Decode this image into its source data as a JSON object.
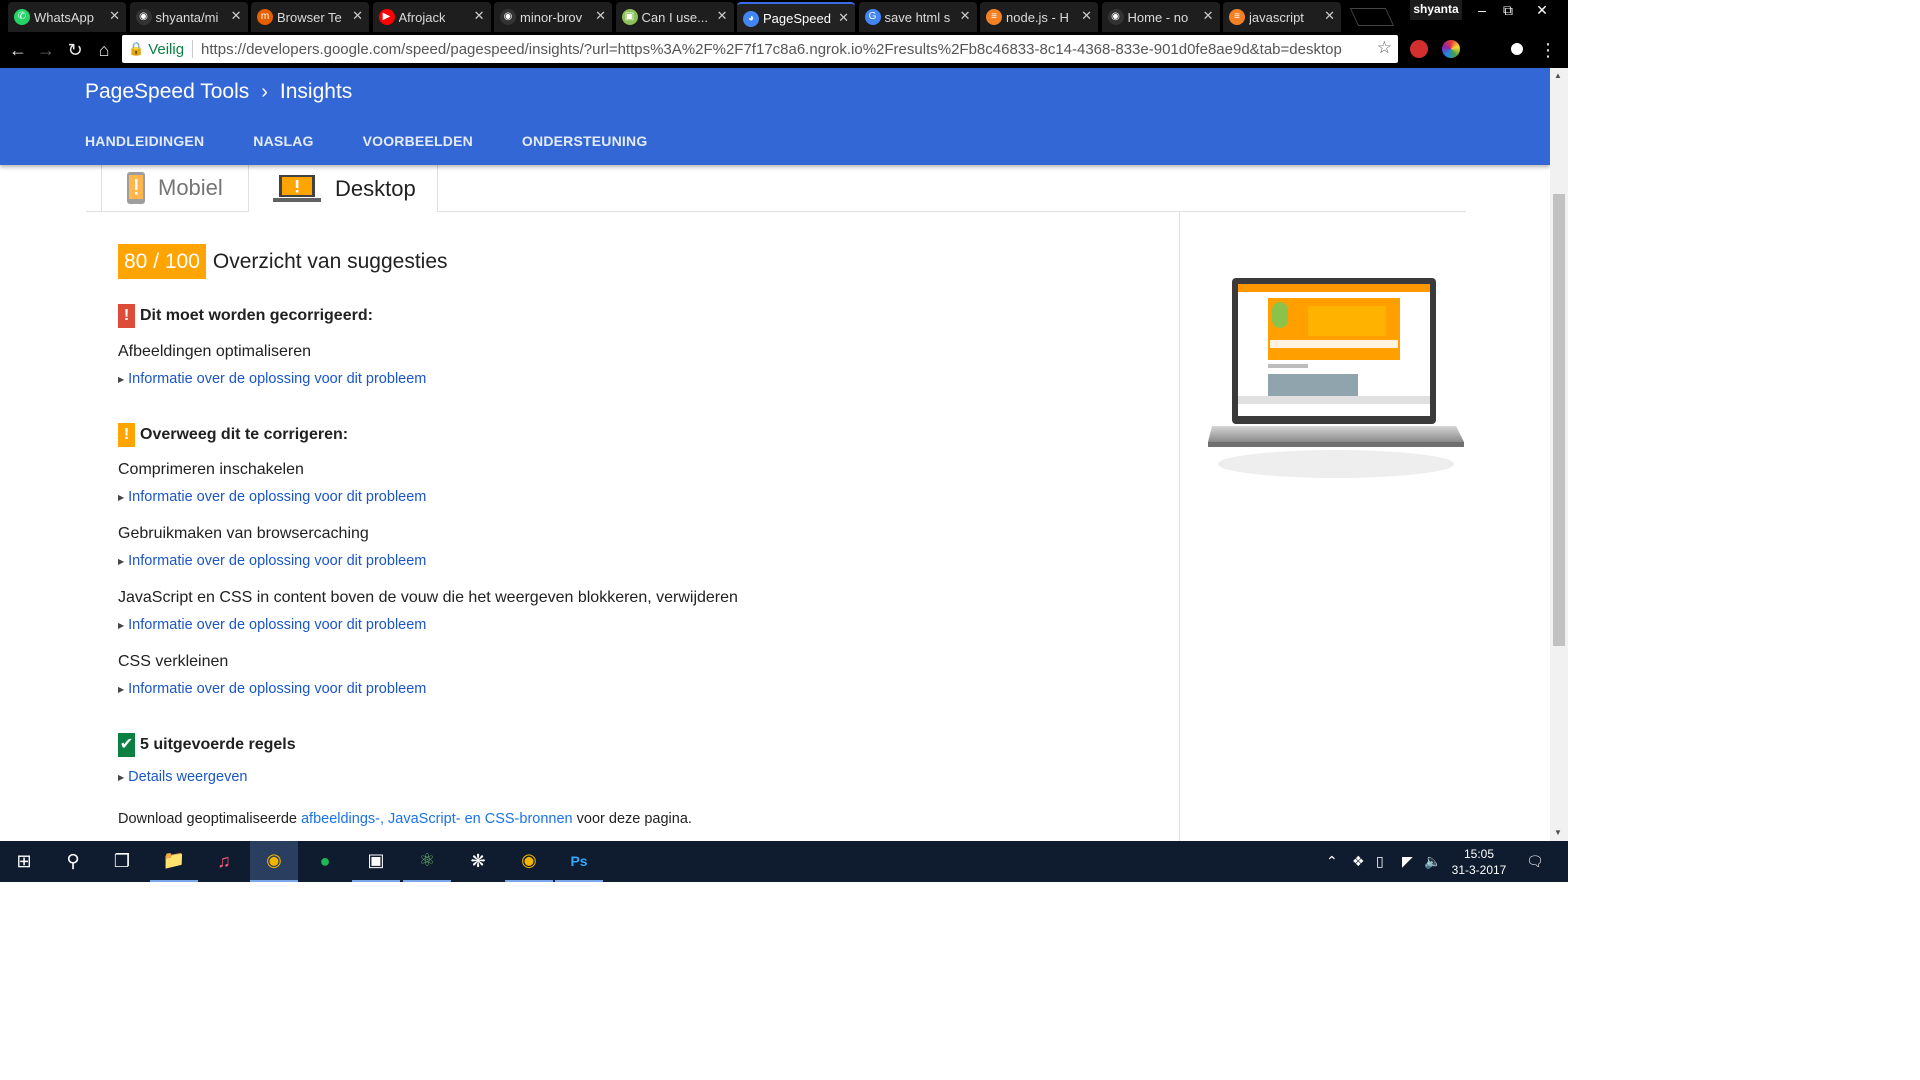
{
  "browser": {
    "tabs": [
      {
        "title": "WhatsApp",
        "icon": "whatsapp-icon",
        "color": "#25d366"
      },
      {
        "title": "shyanta/mi",
        "icon": "github-icon",
        "color": "#333333"
      },
      {
        "title": "Browser Te",
        "icon": "mozilla-icon",
        "color": "#e66000"
      },
      {
        "title": "Afrojack",
        "icon": "youtube-icon",
        "color": "#ff0000"
      },
      {
        "title": "minor-brov",
        "icon": "github-icon",
        "color": "#333333"
      },
      {
        "title": "Can I use...",
        "icon": "caniuse-icon",
        "color": "#8dbf5a"
      },
      {
        "title": "PageSpeed",
        "icon": "pagespeed-icon",
        "color": "#4285f4"
      },
      {
        "title": "save html s",
        "icon": "google-icon",
        "color": "#4285f4"
      },
      {
        "title": "node.js - H",
        "icon": "stackoverflow-icon",
        "color": "#f48024"
      },
      {
        "title": "Home - no",
        "icon": "github-icon",
        "color": "#333333"
      },
      {
        "title": "javascript",
        "icon": "stackoverflow-icon",
        "color": "#f48024"
      }
    ],
    "active_tab_index": 6,
    "profile_name": "shyanta",
    "secure_label": "Veilig",
    "url": "https://developers.google.com/speed/pagespeed/insights/?url=https%3A%2F%2F7f17c8a6.ngrok.io%2Fresults%2Fb8c46833-8c14-4368-833e-901d0fe8ae9d&tab=desktop"
  },
  "header": {
    "breadcrumb_root": "PageSpeed Tools",
    "breadcrumb_current": "Insights",
    "nav": [
      "HANDLEIDINGEN",
      "NASLAG",
      "VOORBEELDEN",
      "ONDERSTEUNING"
    ]
  },
  "device_tabs": {
    "mobile": "Mobiel",
    "desktop": "Desktop",
    "active": "desktop"
  },
  "results": {
    "score": "80 / 100",
    "title": "Overzicht van suggesties",
    "must_fix": {
      "heading": "Dit moet worden gecorrigeerd:",
      "rules": [
        "Afbeeldingen optimaliseren"
      ]
    },
    "consider_fix": {
      "heading": "Overweeg dit te corrigeren:",
      "rules": [
        "Comprimeren inschakelen",
        "Gebruikmaken van browsercaching",
        "JavaScript en CSS in content boven de vouw die het weergeven blokkeren, verwijderen",
        "CSS verkleinen"
      ]
    },
    "info_link": "Informatie over de oplossing voor dit probleem",
    "passed": {
      "heading": "5 uitgevoerde regels",
      "details_link": "Details weergeven"
    },
    "download": {
      "prefix": "Download geoptimaliseerde ",
      "link": "afbeeldings-, JavaScript- en CSS-bronnen",
      "suffix": " voor deze pagina."
    },
    "colors": {
      "score": "#ffa400",
      "must_fix": "#dd4b39",
      "consider": "#ffa400",
      "passed": "#0b8043",
      "header": "#3367d6"
    }
  },
  "taskbar": {
    "apps": [
      "start-icon",
      "search-icon",
      "task-view-icon",
      "file-explorer-icon",
      "itunes-icon",
      "chrome-icon",
      "spotify-icon",
      "terminal-icon",
      "atom-icon",
      "slack-icon",
      "chrome-icon",
      "photoshop-icon"
    ],
    "time": "15:05",
    "date": "31-3-2017"
  }
}
